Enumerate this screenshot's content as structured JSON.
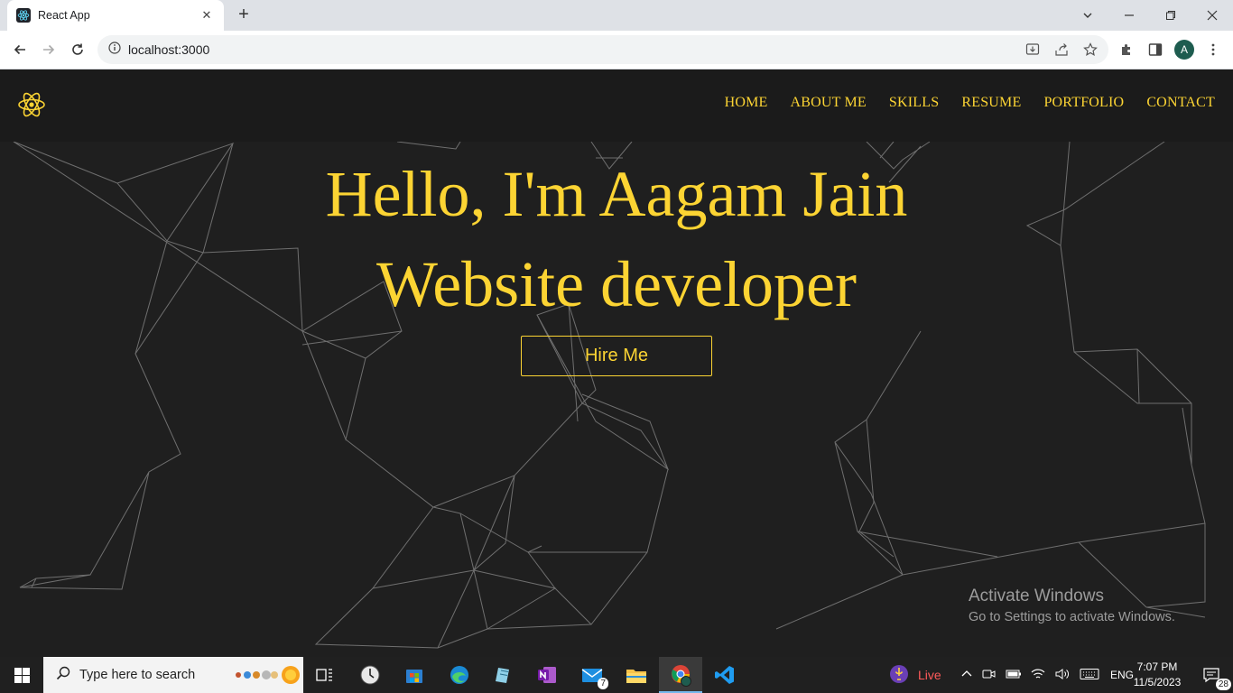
{
  "browser": {
    "tab_title": "React App",
    "url": "localhost:3000",
    "profile_initial": "A"
  },
  "site": {
    "nav": [
      "HOME",
      "ABOUT ME",
      "SKILLS",
      "RESUME",
      "PORTFOLIO",
      "CONTACT"
    ],
    "hero_line1": "Hello, I'm Aagam Jain",
    "hero_line2": "Website developer",
    "cta": "Hire Me",
    "accent_color": "#fcd433",
    "background_color": "#1f1f1f"
  },
  "watermark": {
    "line1": "Activate Windows",
    "line2": "Go to Settings to activate Windows."
  },
  "taskbar": {
    "search_placeholder": "Type here to search",
    "live_label": "Live",
    "language": "ENG",
    "time": "7:07 PM",
    "date": "11/5/2023",
    "notification_count": "28",
    "mail_badge": "7"
  }
}
